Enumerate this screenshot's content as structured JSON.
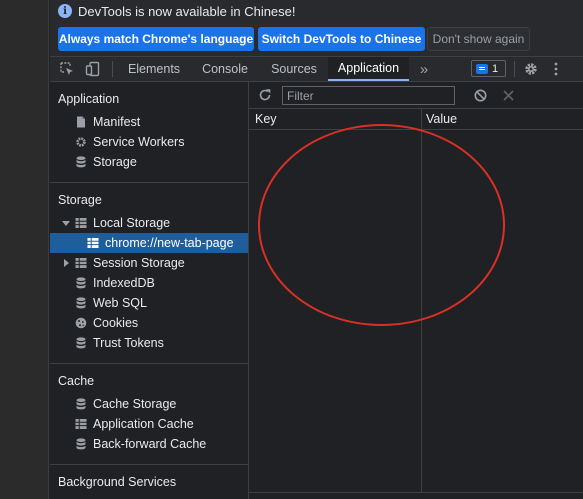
{
  "infobar": {
    "message": "DevTools is now available in Chinese!",
    "buttons": {
      "match_language": "Always match Chrome's language",
      "switch_language": "Switch DevTools to Chinese",
      "dismiss": "Don't show again"
    }
  },
  "tabs": [
    "Elements",
    "Console",
    "Sources",
    "Application"
  ],
  "active_tab": "Application",
  "more_tabs_glyph": "»",
  "issues_count": "1",
  "sidebar": {
    "application": {
      "title": "Application",
      "items": [
        "Manifest",
        "Service Workers",
        "Storage"
      ]
    },
    "storage": {
      "title": "Storage",
      "local_storage": "Local Storage",
      "local_storage_child": "chrome://new-tab-page",
      "session_storage": "Session Storage",
      "items": [
        "IndexedDB",
        "Web SQL",
        "Cookies",
        "Trust Tokens"
      ]
    },
    "cache": {
      "title": "Cache",
      "items": [
        "Cache Storage",
        "Application Cache",
        "Back-forward Cache"
      ]
    },
    "background": {
      "title": "Background Services"
    }
  },
  "main": {
    "filter_placeholder": "Filter",
    "columns": [
      "Key",
      "Value"
    ]
  },
  "colors": {
    "accent": "#8ab4f8",
    "primary_button": "#1a73e8",
    "selection": "#1f5e9c",
    "annotation": "#d93025"
  }
}
